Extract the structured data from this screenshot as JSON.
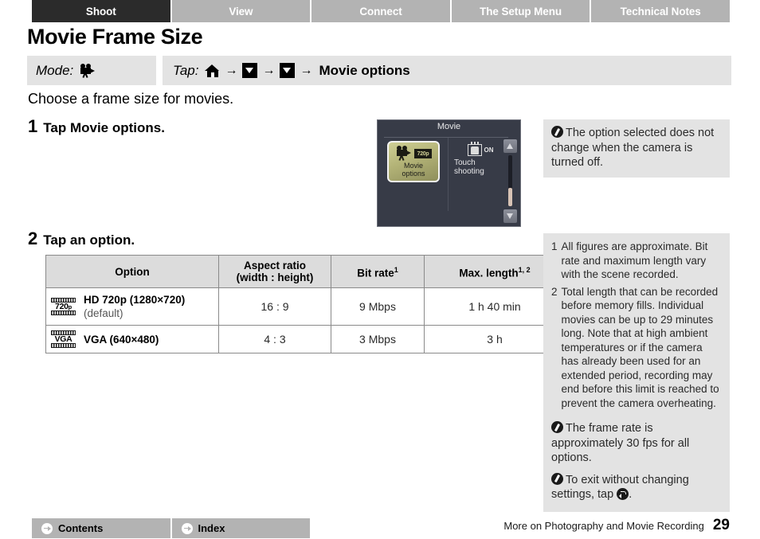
{
  "tabs": [
    {
      "label": "Shoot",
      "active": true
    },
    {
      "label": "View",
      "active": false
    },
    {
      "label": "Connect",
      "active": false
    },
    {
      "label": "The Setup Menu",
      "active": false
    },
    {
      "label": "Technical Notes",
      "active": false
    }
  ],
  "page": {
    "title": "Movie Frame Size",
    "intro": "Choose a frame size for movies."
  },
  "modebar": {
    "mode_label": "Mode:",
    "mode_icon": "movie-camera-icon",
    "tap_label": "Tap:",
    "tap_icons": [
      "home-icon",
      "down-arrow-icon",
      "down-arrow-icon"
    ],
    "tap_arrow": "→",
    "tap_target": "Movie options"
  },
  "steps": [
    {
      "num": "1",
      "text_prefix": "Tap ",
      "text_bold": "Movie options",
      "text_suffix": "."
    },
    {
      "num": "2",
      "text_prefix": "Tap an option.",
      "text_bold": "",
      "text_suffix": ""
    }
  ],
  "lcd": {
    "title": "Movie",
    "tile_label_line1": "Movie",
    "tile_label_line2": "options",
    "tile_icon": "movie-camera-720p-icon",
    "tile_badge": "720p",
    "touch_label": "Touch shooting",
    "touch_state": "ON",
    "touch_icon": "touch-shooting-icon",
    "scroll_up_icon": "scroll-up-triangle-icon",
    "scroll_down_icon": "scroll-down-triangle-icon"
  },
  "table": {
    "headers": {
      "option": "Option",
      "aspect_line1": "Aspect ratio",
      "aspect_line2": "(width : height)",
      "bitrate": "Bit rate",
      "bitrate_sup": "1",
      "maxlen": "Max. length",
      "maxlen_sup": "1, 2"
    },
    "rows": [
      {
        "icon": "film-strip-720p-icon",
        "icon_text": "720",
        "icon_text_sub": "p",
        "name": "HD 720p (1280×720)",
        "sub": "(default)",
        "aspect": "16 : 9",
        "bitrate": "9 Mbps",
        "maxlen": "1 h 40 min"
      },
      {
        "icon": "film-strip-vga-icon",
        "icon_text": "VGA",
        "icon_text_sub": "",
        "name": "VGA (640×480)",
        "sub": "",
        "aspect": "4 : 3",
        "bitrate": "3 Mbps",
        "maxlen": "3 h"
      }
    ]
  },
  "sidebar": {
    "note_top": "The option selected does not change when the camera is turned off.",
    "footnotes": [
      {
        "num": "1",
        "text": "All figures are approximate. Bit rate and maximum length vary with the scene recorded."
      },
      {
        "num": "2",
        "text": "Total length that can be recorded before memory fills. Individual movies can be up to 29 minutes long. Note that at high ambient temperatures or if the camera has already been used for an extended period, recording may end before this limit is reached to prevent the camera overheating."
      }
    ],
    "note_framerate": "The frame rate is approximately 30 fps for all options.",
    "note_exit_prefix": "To exit without changing settings, tap ",
    "note_exit_suffix": ".",
    "note_exit_icon": "back-arrow-icon"
  },
  "footer": {
    "contents_label": "Contents",
    "index_label": "Index",
    "section": "More on Photography and Movie Recording",
    "page_number": "29"
  },
  "colors": {
    "tab_inactive": "#b3b3b3",
    "tab_active": "#2b2b2b",
    "panel_gray": "#e3e3e3",
    "table_header": "#dcdcdc",
    "lcd_bg": "#373b47",
    "lcd_tile": "#b3b377"
  }
}
